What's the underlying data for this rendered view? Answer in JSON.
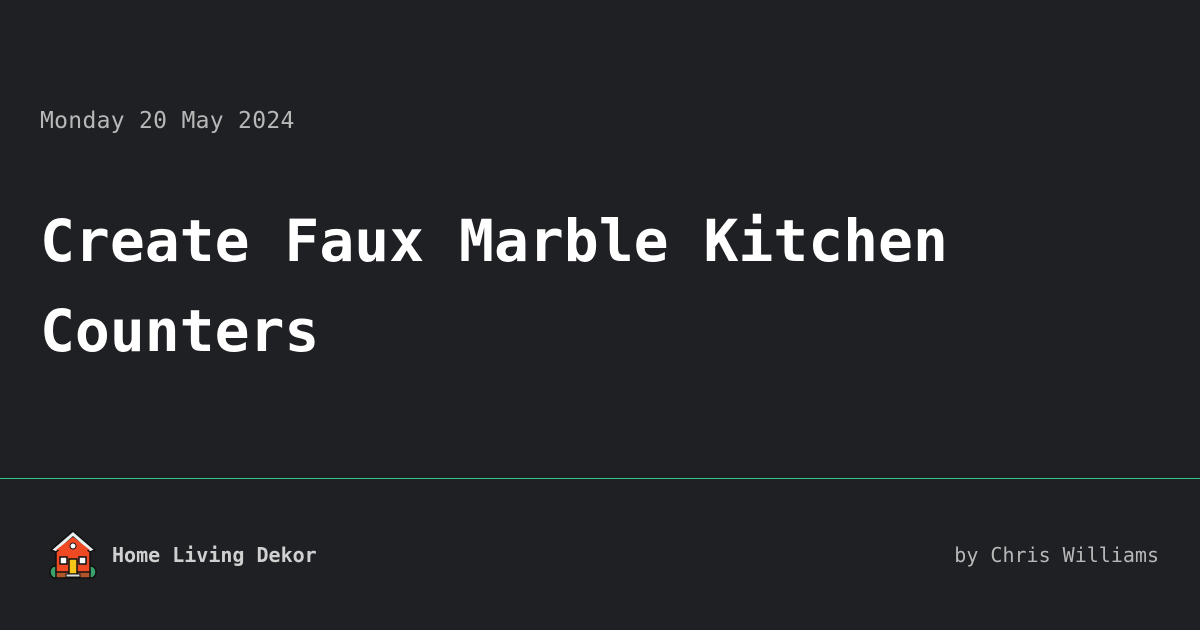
{
  "post": {
    "date": "Monday 20 May 2024",
    "title": "Create Faux Marble Kitchen Counters"
  },
  "footer": {
    "site_name": "Home Living Dekor",
    "author": "by Chris Williams",
    "logo_icon": "house-icon"
  },
  "colors": {
    "background": "#1f2023",
    "accent_line": "#2ec98a"
  }
}
